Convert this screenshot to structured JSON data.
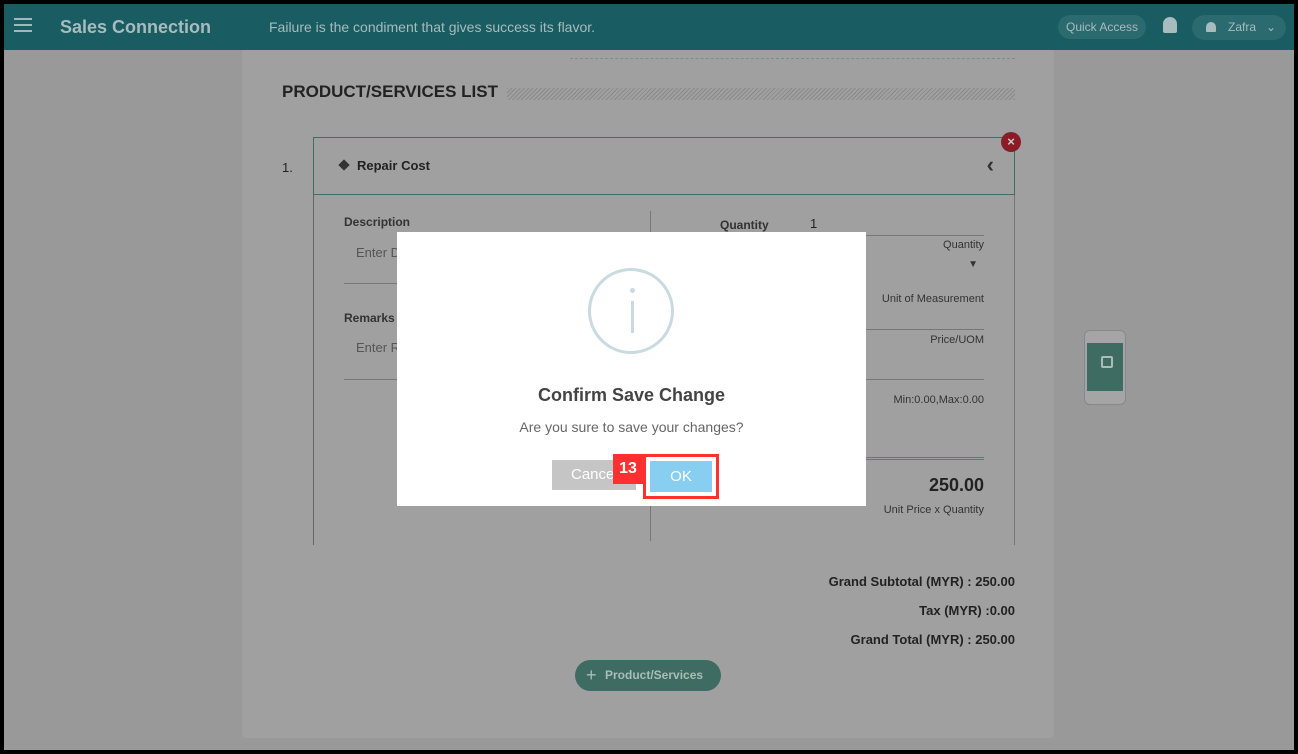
{
  "header": {
    "app_title": "Sales Connection",
    "quote": "Failure is the condiment that gives success its flavor.",
    "quick_access": "Quick Access",
    "user": "Zafra",
    "icons": [
      "menu-icon",
      "bell-icon",
      "user-icon",
      "chevron-down-icon"
    ]
  },
  "section": {
    "title": "PRODUCT/SERVICES LIST"
  },
  "item": {
    "number": "1.",
    "name": "Repair Cost",
    "description_label": "Description",
    "description_placeholder": "Enter D",
    "remarks_label": "Remarks",
    "remarks_placeholder": "Enter R",
    "quantity_label": "Quantity",
    "quantity_value": "1",
    "quantity_hint": "Quantity",
    "uom_label": "Unit of Measurement",
    "price_label": "Price/UOM",
    "price_range": "Min:0.00,Max:0.00",
    "line_total": "250.00",
    "line_total_label": "Unit Price x Quantity"
  },
  "totals": {
    "subtotal": "Grand Subtotal (MYR) : 250.00",
    "tax": "Tax (MYR) :0.00",
    "grand_total": "Grand Total (MYR) : 250.00"
  },
  "add_button": "Product/Services",
  "dialog": {
    "title": "Confirm Save Change",
    "message": "Are you sure to save your changes?",
    "cancel": "Cance",
    "ok": "OK"
  },
  "annotation": {
    "label": "13",
    "color": "#ff3030"
  },
  "colors": {
    "header": "#195c62",
    "accent": "#3e6b62",
    "ok": "#87cef0"
  }
}
